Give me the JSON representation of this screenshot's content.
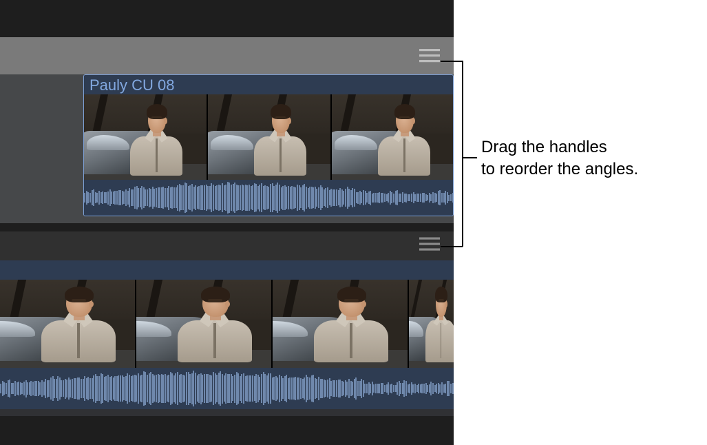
{
  "angles": [
    {
      "clip_title": "Pauly CU 08",
      "handle_icon": "reorder-icon"
    },
    {
      "clip_title": "",
      "handle_icon": "reorder-icon"
    }
  ],
  "callout": {
    "line1": "Drag the handles",
    "line2": "to reorder the angles."
  },
  "colors": {
    "clip_border": "#7da0d6",
    "clip_fill": "#374a66",
    "title_text": "#82a8e0",
    "header_light": "#7a7a7a",
    "header_dark": "#303030",
    "waveform": "#6f88ac"
  }
}
